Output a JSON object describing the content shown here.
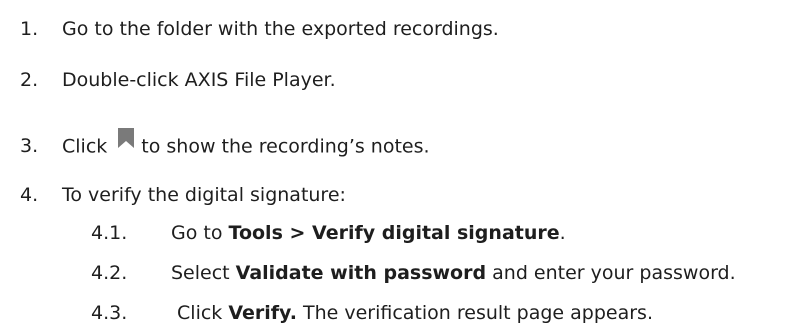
{
  "steps": [
    {
      "number": "1.",
      "text": "Go to the folder with the exported recordings."
    },
    {
      "number": "2.",
      "text": "Double-click AXIS File Player."
    },
    {
      "number": "3.",
      "prefix": "Click",
      "icon": "bookmark-icon",
      "suffix": "to show the recording’s notes."
    },
    {
      "number": "4.",
      "text": "To verify the digital signature:"
    }
  ],
  "substeps": [
    {
      "number": "4.1.",
      "pre": "Go to ",
      "bold": "Tools > Verify digital signature",
      "post": "."
    },
    {
      "number": "4.2.",
      "pre": "Select ",
      "bold": "Validate with password",
      "post": " and enter your password."
    },
    {
      "number": "4.3.",
      "pre": " Click ",
      "bold": "Verify.",
      "post": " The verification result page appears."
    }
  ],
  "colors": {
    "text": "#1e1e1e",
    "icon": "#7a7a7a"
  }
}
